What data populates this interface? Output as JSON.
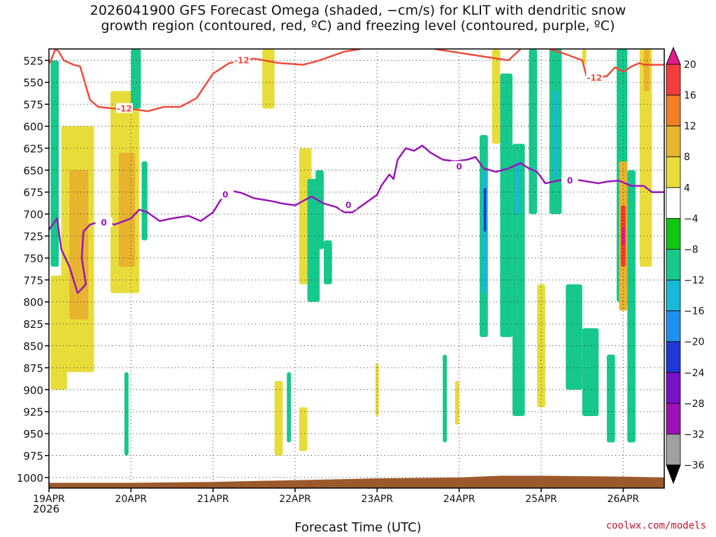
{
  "title_line1": "2026041900 GFS Forecast Omega (shaded, −cm/s) for KLIT with dendritic snow",
  "title_line2": "growth region (contoured, red, ºC) and freezing level (contoured, purple, ºC)",
  "credit": "coolwx.com/models",
  "colors": {
    "dgz": "#f04a3a",
    "freezing": "#9a14b8",
    "ground": "#9c5a2c"
  },
  "chart_data": {
    "type": "heatmap",
    "title": "2026041900 GFS Forecast Omega (shaded, −cm/s) for KLIT with dendritic snow growth region (contoured, red, ºC) and freezing level (contoured, purple, ºC)",
    "xlabel": "Forecast Time (UTC)",
    "year_label": "2026",
    "x_ticks": [
      "19APR",
      "20APR",
      "21APR",
      "22APR",
      "23APR",
      "24APR",
      "25APR",
      "26APR"
    ],
    "x_range_days": [
      0,
      7.5
    ],
    "y_ticks": [
      "525",
      "550",
      "575",
      "600",
      "625",
      "650",
      "675",
      "700",
      "725",
      "750",
      "775",
      "800",
      "825",
      "850",
      "875",
      "900",
      "925",
      "950",
      "975",
      "1000"
    ],
    "y_range_hpa": [
      512,
      1012
    ],
    "colorbar": {
      "labels": [
        "20",
        "16",
        "12",
        "8",
        "4",
        "−4",
        "−8",
        "−12",
        "−16",
        "−20",
        "−24",
        "−28",
        "−32",
        "−36"
      ],
      "colors": [
        "#e31a8c",
        "#f53c3c",
        "#f07e22",
        "#e8b32e",
        "#e8dc3a",
        "#ffffff",
        "#12c612",
        "#16c88c",
        "#18b8d8",
        "#1e90ef",
        "#2038d8",
        "#7a10c8",
        "#a010b8",
        "#a0a0a0",
        "#000000"
      ]
    },
    "contours": {
      "dgz_label": "-12",
      "freezing_label": "0",
      "dgz_line": [
        [
          0.01,
          528
        ],
        [
          0.08,
          512
        ],
        [
          0.12,
          515
        ],
        [
          0.18,
          525
        ],
        [
          0.3,
          530
        ],
        [
          0.38,
          532
        ],
        [
          0.5,
          570
        ],
        [
          0.6,
          578
        ],
        [
          0.8,
          580
        ],
        [
          1.0,
          580
        ],
        [
          1.2,
          583
        ],
        [
          1.4,
          578
        ],
        [
          1.6,
          578
        ],
        [
          1.8,
          568
        ],
        [
          2.0,
          540
        ],
        [
          2.2,
          528
        ],
        [
          2.5,
          523
        ],
        [
          2.8,
          528
        ],
        [
          3.1,
          530
        ],
        [
          3.3,
          525
        ],
        [
          3.6,
          515
        ],
        [
          3.8,
          512
        ]
      ],
      "dgz_line_b": [
        [
          4.7,
          512
        ],
        [
          5.25,
          520
        ],
        [
          5.4,
          522
        ],
        [
          5.6,
          525
        ],
        [
          5.75,
          512
        ]
      ],
      "dgz_line_c": [
        [
          6.1,
          512
        ],
        [
          6.3,
          518
        ],
        [
          6.5,
          525
        ],
        [
          6.55,
          542
        ],
        [
          6.65,
          545
        ],
        [
          6.8,
          543
        ],
        [
          6.9,
          533
        ],
        [
          7.0,
          538
        ],
        [
          7.1,
          532
        ],
        [
          7.2,
          528
        ],
        [
          7.25,
          530
        ],
        [
          7.4,
          530
        ],
        [
          7.5,
          530
        ]
      ],
      "freezing_line": [
        [
          0,
          718
        ],
        [
          0.1,
          705
        ],
        [
          0.15,
          740
        ],
        [
          0.25,
          760
        ],
        [
          0.3,
          775
        ],
        [
          0.35,
          790
        ],
        [
          0.45,
          780
        ],
        [
          0.4,
          750
        ],
        [
          0.42,
          720
        ],
        [
          0.5,
          712
        ],
        [
          0.65,
          708
        ],
        [
          0.8,
          712
        ],
        [
          1.0,
          705
        ],
        [
          1.1,
          695
        ],
        [
          1.2,
          698
        ],
        [
          1.35,
          708
        ],
        [
          1.5,
          705
        ],
        [
          1.7,
          702
        ],
        [
          1.85,
          708
        ],
        [
          2.0,
          698
        ],
        [
          2.1,
          683
        ],
        [
          2.25,
          674
        ],
        [
          2.35,
          676
        ],
        [
          2.5,
          682
        ],
        [
          2.7,
          685
        ],
        [
          2.85,
          688
        ],
        [
          3.0,
          690
        ],
        [
          3.1,
          685
        ],
        [
          3.2,
          680
        ],
        [
          3.35,
          688
        ],
        [
          3.5,
          692
        ],
        [
          3.6,
          698
        ],
        [
          3.7,
          698
        ],
        [
          3.85,
          688
        ],
        [
          4.0,
          678
        ],
        [
          4.05,
          668
        ],
        [
          4.15,
          655
        ],
        [
          4.2,
          660
        ],
        [
          4.25,
          638
        ],
        [
          4.35,
          625
        ],
        [
          4.45,
          628
        ],
        [
          4.55,
          622
        ],
        [
          4.65,
          630
        ],
        [
          4.8,
          638
        ],
        [
          4.95,
          640
        ],
        [
          5.1,
          638
        ],
        [
          5.2,
          635
        ],
        [
          5.3,
          648
        ],
        [
          5.45,
          652
        ],
        [
          5.6,
          648
        ],
        [
          5.75,
          642
        ],
        [
          5.85,
          648
        ],
        [
          5.95,
          652
        ],
        [
          6.05,
          665
        ],
        [
          6.2,
          662
        ],
        [
          6.35,
          660
        ],
        [
          6.5,
          662
        ],
        [
          6.7,
          665
        ],
        [
          6.8,
          663
        ],
        [
          6.95,
          662
        ],
        [
          7.1,
          668
        ],
        [
          7.25,
          668
        ],
        [
          7.35,
          675
        ],
        [
          7.5,
          675
        ]
      ]
    },
    "omega_cells": [
      {
        "x0": 0.02,
        "x1": 0.12,
        "p0": 525,
        "p1": 760,
        "v": -8
      },
      {
        "x0": 0.15,
        "x1": 0.55,
        "p0": 600,
        "p1": 880,
        "v": 6
      },
      {
        "x0": 0.25,
        "x1": 0.48,
        "p0": 650,
        "p1": 820,
        "v": 10
      },
      {
        "x0": 0.02,
        "x1": 0.22,
        "p0": 770,
        "p1": 900,
        "v": 6
      },
      {
        "x0": 0.75,
        "x1": 1.1,
        "p0": 560,
        "p1": 790,
        "v": 6
      },
      {
        "x0": 0.85,
        "x1": 1.05,
        "p0": 630,
        "p1": 760,
        "v": 10
      },
      {
        "x0": 1.0,
        "x1": 1.12,
        "p0": 512,
        "p1": 580,
        "v": -8
      },
      {
        "x0": 1.13,
        "x1": 1.2,
        "p0": 640,
        "p1": 730,
        "v": -8
      },
      {
        "x0": 0.92,
        "x1": 0.97,
        "p0": 880,
        "p1": 975,
        "v": -8
      },
      {
        "x0": 2.6,
        "x1": 2.75,
        "p0": 512,
        "p1": 580,
        "v": 6
      },
      {
        "x0": 3.05,
        "x1": 3.2,
        "p0": 625,
        "p1": 780,
        "v": 6
      },
      {
        "x0": 3.15,
        "x1": 3.3,
        "p0": 660,
        "p1": 800,
        "v": -8
      },
      {
        "x0": 3.25,
        "x1": 3.35,
        "p0": 650,
        "p1": 740,
        "v": -8
      },
      {
        "x0": 3.35,
        "x1": 3.45,
        "p0": 730,
        "p1": 780,
        "v": -8
      },
      {
        "x0": 2.75,
        "x1": 2.85,
        "p0": 890,
        "p1": 975,
        "v": 6
      },
      {
        "x0": 2.9,
        "x1": 2.95,
        "p0": 880,
        "p1": 960,
        "v": -8
      },
      {
        "x0": 3.05,
        "x1": 3.15,
        "p0": 920,
        "p1": 970,
        "v": 6
      },
      {
        "x0": 3.98,
        "x1": 4.02,
        "p0": 870,
        "p1": 930,
        "v": 6
      },
      {
        "x0": 4.8,
        "x1": 4.85,
        "p0": 860,
        "p1": 960,
        "v": -8
      },
      {
        "x0": 4.95,
        "x1": 5.0,
        "p0": 890,
        "p1": 940,
        "v": 6
      },
      {
        "x0": 5.25,
        "x1": 5.35,
        "p0": 610,
        "p1": 840,
        "v": -8
      },
      {
        "x0": 5.28,
        "x1": 5.34,
        "p0": 650,
        "p1": 790,
        "v": -14
      },
      {
        "x0": 5.3,
        "x1": 5.33,
        "p0": 670,
        "p1": 720,
        "v": -22
      },
      {
        "x0": 5.4,
        "x1": 5.5,
        "p0": 512,
        "p1": 620,
        "v": 6
      },
      {
        "x0": 5.5,
        "x1": 5.65,
        "p0": 540,
        "p1": 840,
        "v": -8
      },
      {
        "x0": 5.65,
        "x1": 5.8,
        "p0": 620,
        "p1": 930,
        "v": -8
      },
      {
        "x0": 5.68,
        "x1": 5.74,
        "p0": 640,
        "p1": 700,
        "v": -14
      },
      {
        "x0": 5.85,
        "x1": 5.95,
        "p0": 512,
        "p1": 700,
        "v": -8
      },
      {
        "x0": 5.95,
        "x1": 6.05,
        "p0": 780,
        "p1": 920,
        "v": 6
      },
      {
        "x0": 6.1,
        "x1": 6.25,
        "p0": 512,
        "p1": 700,
        "v": -8
      },
      {
        "x0": 6.15,
        "x1": 6.2,
        "p0": 560,
        "p1": 660,
        "v": -14
      },
      {
        "x0": 6.3,
        "x1": 6.5,
        "p0": 780,
        "p1": 900,
        "v": -8
      },
      {
        "x0": 6.5,
        "x1": 6.7,
        "p0": 830,
        "p1": 930,
        "v": -8
      },
      {
        "x0": 6.5,
        "x1": 6.55,
        "p0": 512,
        "p1": 530,
        "v": 6
      },
      {
        "x0": 6.8,
        "x1": 6.9,
        "p0": 860,
        "p1": 960,
        "v": -8
      },
      {
        "x0": 6.92,
        "x1": 7.05,
        "p0": 512,
        "p1": 800,
        "v": -8
      },
      {
        "x0": 6.95,
        "x1": 7.05,
        "p0": 640,
        "p1": 810,
        "v": 10
      },
      {
        "x0": 6.97,
        "x1": 7.03,
        "p0": 690,
        "p1": 760,
        "v": 16
      },
      {
        "x0": 6.98,
        "x1": 7.02,
        "p0": 715,
        "p1": 735,
        "v": 20
      },
      {
        "x0": 7.05,
        "x1": 7.15,
        "p0": 650,
        "p1": 960,
        "v": -8
      },
      {
        "x0": 7.2,
        "x1": 7.35,
        "p0": 512,
        "p1": 760,
        "v": 6
      },
      {
        "x0": 7.25,
        "x1": 7.32,
        "p0": 512,
        "p1": 560,
        "v": 10
      }
    ],
    "ground_surface": [
      [
        0,
        1006
      ],
      [
        1.0,
        1006
      ],
      [
        2.0,
        1005
      ],
      [
        3.0,
        1003
      ],
      [
        4.0,
        1001
      ],
      [
        5.0,
        1000
      ],
      [
        5.5,
        998
      ],
      [
        6.0,
        998
      ],
      [
        7.0,
        999
      ],
      [
        7.5,
        1000
      ]
    ]
  }
}
